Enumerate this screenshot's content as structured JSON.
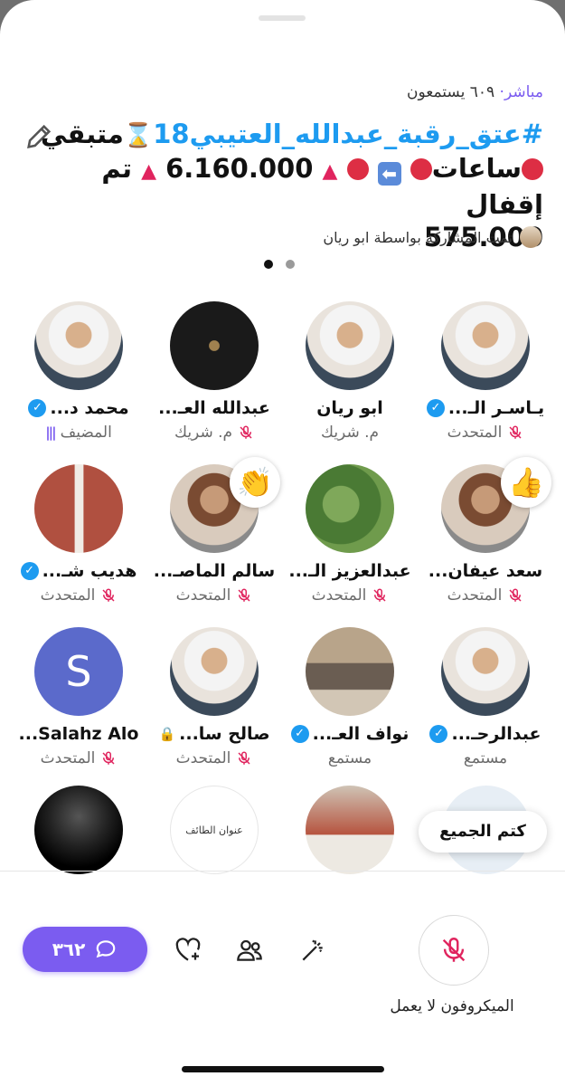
{
  "header": {
    "live_label": "مباشر·",
    "listeners": "٦٠٩ يستمعون",
    "title_line1_a": "#عتق_رقبة_عبدالله_العتيبي18",
    "title_line1_b": "متبقي",
    "title_line2_a": "ساعات",
    "title_line2_b": "6.160.000",
    "title_line2_c": "تم إقفال",
    "title_line3": "575.000",
    "shared_by": "تمت المشاركة بواسطة ابو ريان"
  },
  "participants": [
    {
      "name": "يـاسـر الـ...",
      "role": "المتحدث",
      "verified": true,
      "muted": true,
      "avatar": "photo-man-ghutra"
    },
    {
      "name": "ابو ريان",
      "role": "م. شريك",
      "verified": false,
      "muted": false,
      "avatar": "photo-man-ghutra"
    },
    {
      "name": "عبدالله العـ...",
      "role": "م. شريك",
      "verified": false,
      "muted": true,
      "avatar": "logo-abu-saqr"
    },
    {
      "name": "محمد د...",
      "role": "المضيف",
      "verified": true,
      "muted": false,
      "avatar": "photo-man-ghutra"
    },
    {
      "name": "سعد عيفان...",
      "role": "المتحدث",
      "verified": false,
      "muted": true,
      "avatar": "photo-man",
      "reaction": "👍"
    },
    {
      "name": "عبدالعزيز الـ...",
      "role": "المتحدث",
      "verified": false,
      "muted": true,
      "avatar": "photo-plants"
    },
    {
      "name": "سالم الماصـ...",
      "role": "المتحدث",
      "verified": false,
      "muted": true,
      "avatar": "photo-man",
      "reaction": "👏"
    },
    {
      "name": "هديب شـ...",
      "role": "المتحدث",
      "verified": true,
      "muted": true,
      "avatar": "photo-two-men"
    },
    {
      "name": "عبدالرحـ...",
      "role": "مستمع",
      "verified": true,
      "muted": false,
      "avatar": "photo-man-ghutra"
    },
    {
      "name": "نواف العـ...",
      "role": "مستمع",
      "verified": true,
      "muted": false,
      "avatar": "photo-man-seated"
    },
    {
      "name": "صالح سا...",
      "role": "المتحدث",
      "verified": false,
      "muted": true,
      "locked": true,
      "avatar": "photo-man-ghutra"
    },
    {
      "name": "Salahz Alo...",
      "role": "المتحدث",
      "verified": false,
      "muted": true,
      "avatar": "letter",
      "letter": "S"
    }
  ],
  "row4": {
    "card_text": "عنوان الطائف"
  },
  "controls": {
    "mute_all": "كتم الجميع",
    "mic_label": "الميكروفون لا يعمل",
    "chat_count": "٣٦٢"
  },
  "colors": {
    "accent": "#7b5cf0",
    "verified": "#1d9bf0",
    "mute": "#e0245e"
  }
}
